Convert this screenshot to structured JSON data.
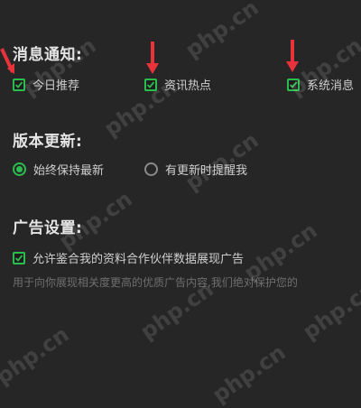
{
  "notifications": {
    "title": "消息通知:",
    "items": [
      {
        "label": "今日推荐",
        "checked": true
      },
      {
        "label": "资讯热点",
        "checked": true
      },
      {
        "label": "系统消息",
        "checked": true
      }
    ]
  },
  "updates": {
    "title": "版本更新:",
    "options": [
      {
        "label": "始终保持最新",
        "selected": true
      },
      {
        "label": "有更新时提醒我",
        "selected": false
      }
    ]
  },
  "ads": {
    "title": "广告设置:",
    "checkbox_label": "允许鉴合我的资料合作伙伴数据展现广告",
    "checked": true,
    "description": "用于向你展现相关度更高的优质广告内容,我们绝对保护您的"
  },
  "colors": {
    "accent": "#2bbd4e",
    "annotation_arrow": "#e8323c"
  },
  "watermark": "php.cn"
}
